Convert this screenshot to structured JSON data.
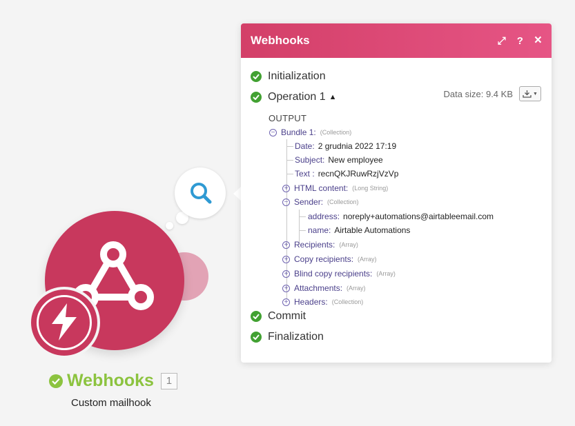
{
  "module": {
    "name": "Webhooks",
    "index": "1",
    "subtitle": "Custom mailhook",
    "icon": "webhook-icon",
    "badge_icon": "lightning-icon",
    "color": "#c8385d"
  },
  "panel": {
    "title": "Webhooks",
    "buttons": {
      "expand": "⤢",
      "help": "?",
      "close": "×"
    },
    "steps": {
      "initialization": "Initialization",
      "operation": "Operation 1",
      "commit": "Commit",
      "finalization": "Finalization"
    },
    "data_size": "Data size: 9.4 KB",
    "output_label": "OUTPUT",
    "tree": {
      "bundle": {
        "key": "Bundle 1:",
        "type": "(Collection)"
      },
      "date": {
        "key": "Date:",
        "value": "2 grudnia 2022 17:19"
      },
      "subject": {
        "key": "Subject:",
        "value": "New employee"
      },
      "text": {
        "key": "Text :",
        "value": "recnQKJRuwRzjVzVp"
      },
      "html": {
        "key": "HTML content:",
        "type": "(Long String)"
      },
      "sender": {
        "key": "Sender:",
        "type": "(Collection)"
      },
      "address": {
        "key": "address:",
        "value": "noreply+automations@airtableemail.com"
      },
      "name": {
        "key": "name:",
        "value": "Airtable Automations"
      },
      "recipients": {
        "key": "Recipients:",
        "type": "(Array)"
      },
      "copy": {
        "key": "Copy recipients:",
        "type": "(Array)"
      },
      "blind": {
        "key": "Blind copy recipients:",
        "type": "(Array)"
      },
      "attachments": {
        "key": "Attachments:",
        "type": "(Array)"
      },
      "headers": {
        "key": "Headers:",
        "type": "(Collection)"
      }
    },
    "colors": {
      "header": "#d33f68",
      "success": "#42a132",
      "key": "#4a3f8a"
    }
  }
}
